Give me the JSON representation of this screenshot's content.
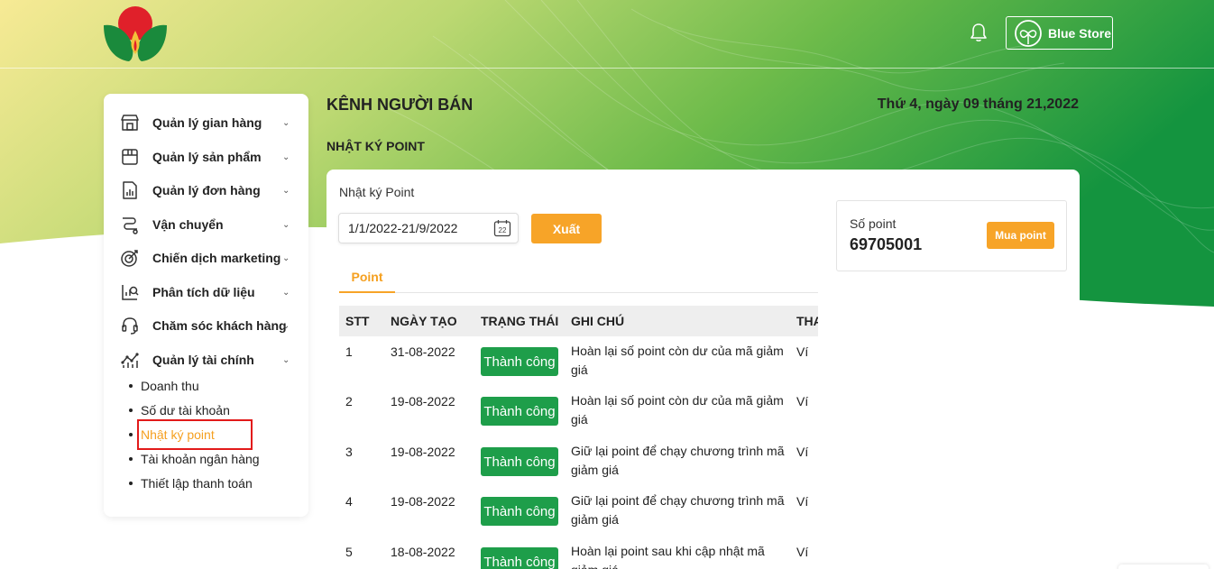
{
  "header": {
    "store_name": "Blue Store",
    "logo_icon": "four-leaf-logo-icon",
    "notification_icon": "bell-icon"
  },
  "colors": {
    "accent": "#f7a428",
    "success": "#1e9e4a",
    "brand_red": "#e0202a",
    "brand_green": "#1a8a3c",
    "highlight_box": "#e21a1a"
  },
  "sidebar": {
    "items": [
      {
        "label": "Quản lý gian hàng",
        "icon": "store-icon"
      },
      {
        "label": "Quản lý sản phẩm",
        "icon": "box-icon"
      },
      {
        "label": "Quản lý đơn hàng",
        "icon": "order-report-icon"
      },
      {
        "label": "Vận chuyển",
        "icon": "shipping-map-icon"
      },
      {
        "label": "Chiến dịch marketing",
        "icon": "marketing-target-icon"
      },
      {
        "label": "Phân tích dữ liệu",
        "icon": "data-analysis-icon"
      },
      {
        "label": "Chăm sóc khách hàng",
        "icon": "headset-icon"
      },
      {
        "label": "Quản lý tài chính",
        "icon": "finance-chart-icon"
      }
    ],
    "finance_sub_items": [
      {
        "label": "Doanh thu"
      },
      {
        "label": "Số dư tài khoản"
      },
      {
        "label": "Nhật ký point"
      },
      {
        "label": "Tài khoản ngân hàng"
      },
      {
        "label": "Thiết lập thanh toán"
      }
    ]
  },
  "page": {
    "title": "KÊNH NGƯỜI BÁN",
    "date": "Thứ 4, ngày 09 tháng 21,2022",
    "section_title": "NHẬT KÝ POINT"
  },
  "card": {
    "label": "Nhật ký Point",
    "date_range": "1/1/2022-21/9/2022",
    "calendar_day": "22",
    "export_label": "Xuất",
    "tab_label": "Point"
  },
  "table": {
    "columns": [
      "STT",
      "NGÀY TẠO",
      "TRẠNG THÁI",
      "GHI CHÚ",
      "THA"
    ],
    "rows": [
      {
        "stt": "1",
        "date": "31-08-2022",
        "status": "Thành công",
        "note": "Hoàn lại số point còn dư của mã giảm giá",
        "extra": "Ví"
      },
      {
        "stt": "2",
        "date": "19-08-2022",
        "status": "Thành công",
        "note": "Hoàn lại số point còn dư của mã giảm giá",
        "extra": "Ví"
      },
      {
        "stt": "3",
        "date": "19-08-2022",
        "status": "Thành công",
        "note": "Giữ lại point để chạy chương trình mã giảm giá",
        "extra": "Ví"
      },
      {
        "stt": "4",
        "date": "19-08-2022",
        "status": "Thành công",
        "note": "Giữ lại point để chạy chương trình mã giảm giá",
        "extra": "Ví"
      },
      {
        "stt": "5",
        "date": "18-08-2022",
        "status": "Thành công",
        "note": "Hoàn lại point sau khi cập nhật mã giảm giá",
        "extra": "Ví"
      }
    ]
  },
  "points": {
    "label": "Số point",
    "value": "69705001",
    "buy_label": "Mua point"
  }
}
